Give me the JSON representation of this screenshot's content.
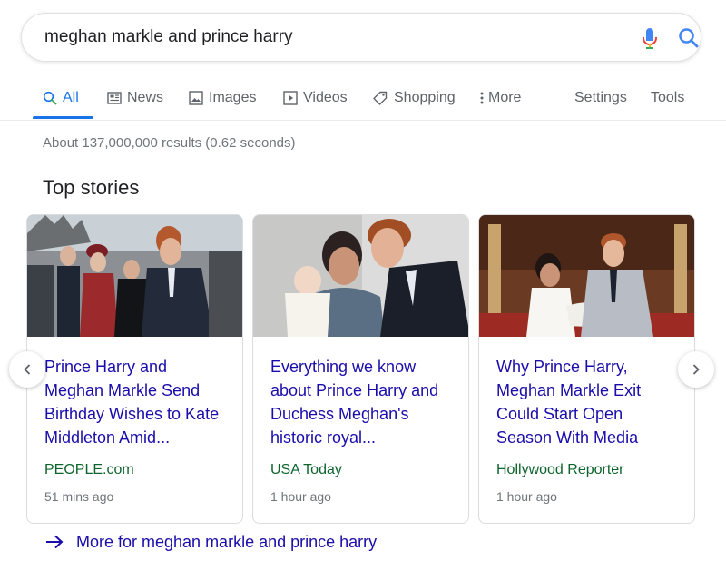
{
  "search": {
    "query": "meghan markle and prince harry",
    "mic_icon": "mic-icon",
    "search_icon": "search-icon"
  },
  "tabs": [
    {
      "label": "All",
      "icon": "search-icon",
      "active": true
    },
    {
      "label": "News",
      "icon": "news-icon"
    },
    {
      "label": "Images",
      "icon": "image-icon"
    },
    {
      "label": "Videos",
      "icon": "video-icon"
    },
    {
      "label": "Shopping",
      "icon": "tag-icon"
    },
    {
      "label": "More",
      "icon": "more-vert-icon"
    },
    {
      "label": "Settings"
    },
    {
      "label": "Tools"
    }
  ],
  "results_count": "About 137,000,000 results (0.62 seconds)",
  "top_stories": {
    "title": "Top stories",
    "cards": [
      {
        "headline": "Prince Harry and Meghan Markle Send Birthday Wishes to Kate Middleton Amid...",
        "source": "PEOPLE.com",
        "time": "51 mins ago"
      },
      {
        "headline": "Everything we know about Prince Harry and Duchess Meghan's historic royal...",
        "source": "USA Today",
        "time": "1 hour ago"
      },
      {
        "headline": "Why Prince Harry, Meghan Markle Exit Could Start Open Season With Media",
        "source": "Hollywood Reporter",
        "time": "1 hour ago"
      }
    ],
    "more_link": "More for meghan markle and prince harry"
  },
  "colors": {
    "link": "#1a0dab",
    "accent": "#1a73e8",
    "source": "#0d652d",
    "muted": "#70757a"
  }
}
